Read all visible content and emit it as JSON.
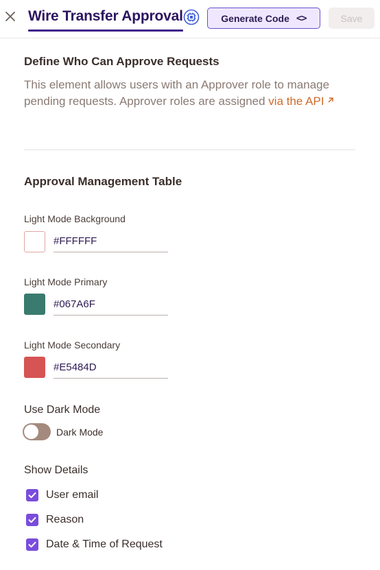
{
  "header": {
    "title": "Wire Transfer Approval",
    "generate_label": "Generate Code",
    "generate_glyph": "<>",
    "save_label": "Save",
    "title_icon": "cpu-chip-icon",
    "close_icon": "close-icon"
  },
  "approvers": {
    "heading": "Define Who Can Approve Requests",
    "description": "This element allows users with an Approver role to manage pending requests. Approver roles are assigned",
    "link_text": "via the API",
    "link_icon": "external-arrow-icon"
  },
  "table": {
    "heading": "Approval Management Table",
    "colors": [
      {
        "label": "Light Mode Background",
        "value": "#FFFFFF"
      },
      {
        "label": "Light Mode Primary",
        "value": "#067A6F"
      },
      {
        "label": "Light Mode Secondary",
        "value": "#E5484D"
      }
    ],
    "dark_mode": {
      "heading": "Use Dark Mode",
      "toggle_label": "Dark Mode",
      "enabled": false
    },
    "details": {
      "heading": "Show Details",
      "options": [
        {
          "label": "User email",
          "checked": true
        },
        {
          "label": "Reason",
          "checked": true
        },
        {
          "label": "Date & Time of Request",
          "checked": true
        }
      ]
    }
  },
  "theme": {
    "accent": "#7a4cdc",
    "title_color": "#2c1560",
    "link_color": "#cf6b2b"
  }
}
